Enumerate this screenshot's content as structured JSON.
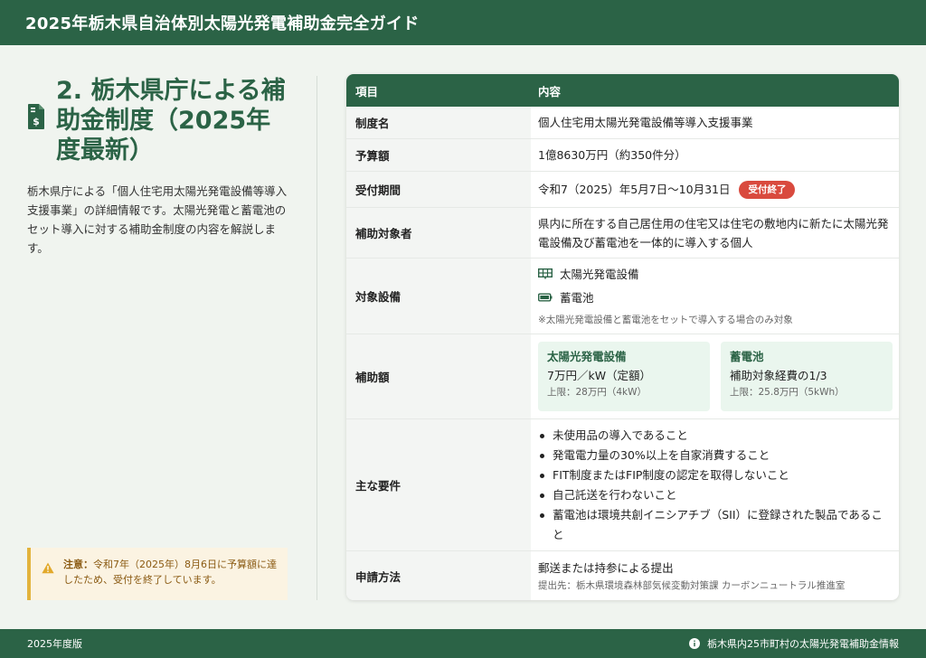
{
  "header": {
    "title": "2025年栃木県自治体別太陽光発電補助金完全ガイド"
  },
  "section": {
    "heading": "2. 栃木県庁による補助金制度（2025年度最新）",
    "description": "栃木県庁による「個人住宅用太陽光発電設備等導入支援事業」の詳細情報です。太陽光発電と蓄電池のセット導入に対する補助金制度の内容を解説します。",
    "notice_label": "注意：",
    "notice_text": "令和7年（2025年）8月6日に予算額に達したため、受付を終了しています。"
  },
  "table": {
    "headers": {
      "item": "項目",
      "content": "内容"
    },
    "program_name": {
      "key": "制度名",
      "value": "個人住宅用太陽光発電設備等導入支援事業"
    },
    "budget": {
      "key": "予算額",
      "value": "1億8630万円（約350件分）"
    },
    "period": {
      "key": "受付期間",
      "value": "令和7（2025）年5月7日〜10月31日",
      "badge": "受付終了"
    },
    "eligible": {
      "key": "補助対象者",
      "value": "県内に所在する自己居住用の住宅又は住宅の敷地内に新たに太陽光発電設備及び蓄電池を一体的に導入する個人"
    },
    "equipment": {
      "key": "対象設備",
      "items": [
        {
          "icon": "solar-panel-icon",
          "label": "太陽光発電設備"
        },
        {
          "icon": "battery-icon",
          "label": "蓄電池"
        }
      ],
      "note": "※太陽光発電設備と蓄電池をセットで導入する場合のみ対象"
    },
    "subsidy": {
      "key": "補助額",
      "solar": {
        "title": "太陽光発電設備",
        "value": "7万円／kW（定額）",
        "limit": "上限：28万円（4kW）"
      },
      "battery": {
        "title": "蓄電池",
        "value": "補助対象経費の1/3",
        "limit": "上限：25.8万円（5kWh）"
      }
    },
    "requirements": {
      "key": "主な要件",
      "items": [
        "未使用品の導入であること",
        "発電電力量の30%以上を自家消費すること",
        "FIT制度またはFIP制度の認定を取得しないこと",
        "自己託送を行わないこと",
        "蓄電池は環境共創イニシアチブ（SII）に登録された製品であること"
      ]
    },
    "application": {
      "key": "申請方法",
      "value": "郵送または持参による提出",
      "sub": "提出先：栃木県環境森林部気候変動対策課 カーボンニュートラル推進室"
    }
  },
  "footer": {
    "left": "2025年度版",
    "right": "栃木県内25市町村の太陽光発電補助金情報"
  },
  "colors": {
    "brand": "#2b6346",
    "badge": "#d94a3e",
    "notice_border": "#e2b33c"
  }
}
